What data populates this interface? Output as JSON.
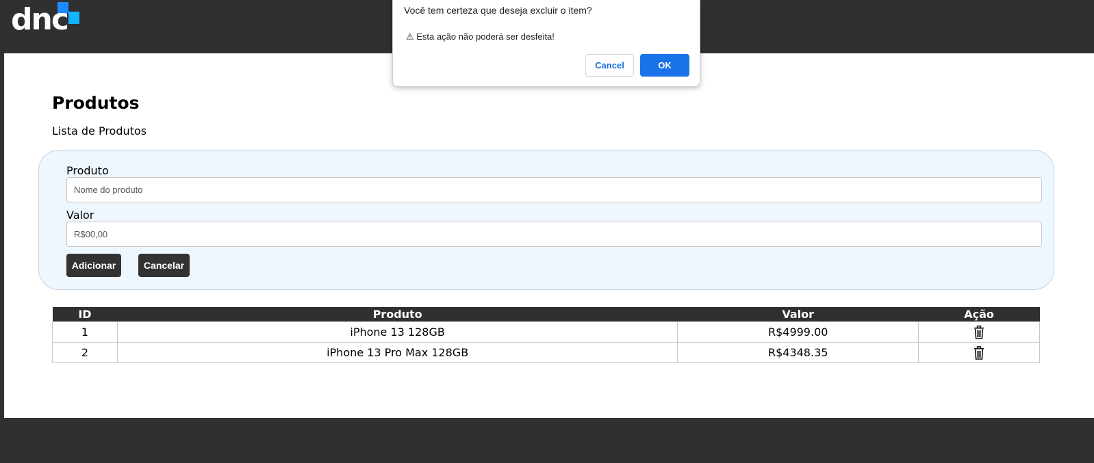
{
  "header": {
    "logo_text": "dnc"
  },
  "page": {
    "title": "Produtos",
    "subtitle": "Lista de Produtos"
  },
  "form": {
    "product_label": "Produto",
    "product_placeholder": "Nome do produto",
    "value_label": "Valor",
    "value_placeholder": "R$00,00",
    "add_button": "Adicionar",
    "cancel_button": "Cancelar"
  },
  "table": {
    "headers": [
      "ID",
      "Produto",
      "Valor",
      "Ação"
    ],
    "rows": [
      {
        "id": "1",
        "product": "iPhone 13 128GB",
        "value": "R$4999.00",
        "action_icon": "trash-icon"
      },
      {
        "id": "2",
        "product": "iPhone 13 Pro Max 128GB",
        "value": "R$4348.35",
        "action_icon": "trash-icon"
      }
    ]
  },
  "dialog": {
    "title": "Você tem certeza que deseja excluir o item?",
    "message": "⚠ Esta ação não poderá ser desfeita!",
    "cancel_label": "Cancel",
    "ok_label": "OK"
  },
  "colors": {
    "background": "#303030",
    "form_bg": "#eef6fe",
    "dark_button": "#333333",
    "dialog_ok": "#1a73e8",
    "logo_blue": "#1a8cff",
    "logo_light_blue": "#13b4ff"
  }
}
